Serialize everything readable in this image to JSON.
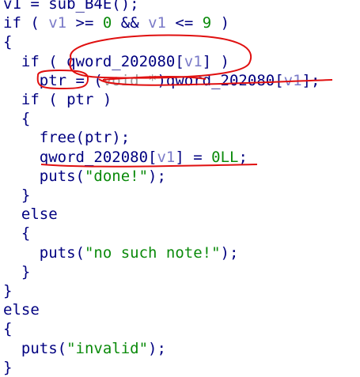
{
  "code": {
    "lines": [
      [
        {
          "t": "v1",
          "c": "plain"
        },
        {
          "t": " = sub_B4E();",
          "c": "plain"
        }
      ],
      [
        {
          "t": "if ( ",
          "c": "plain"
        },
        {
          "t": "v1",
          "c": "var"
        },
        {
          "t": " >= ",
          "c": "plain"
        },
        {
          "t": "0",
          "c": "num"
        },
        {
          "t": " && ",
          "c": "plain"
        },
        {
          "t": "v1",
          "c": "var"
        },
        {
          "t": " <= ",
          "c": "plain"
        },
        {
          "t": "9",
          "c": "num"
        },
        {
          "t": " )",
          "c": "plain"
        }
      ],
      [
        {
          "t": "{",
          "c": "plain"
        }
      ],
      [
        {
          "t": "  if ( qword_202080[",
          "c": "plain"
        },
        {
          "t": "v1",
          "c": "var"
        },
        {
          "t": "] )",
          "c": "plain"
        }
      ],
      [
        {
          "t": "    ptr = (",
          "c": "plain"
        },
        {
          "t": "void *",
          "c": "type"
        },
        {
          "t": ")qword_202080[",
          "c": "plain"
        },
        {
          "t": "v1",
          "c": "var"
        },
        {
          "t": "];",
          "c": "plain"
        }
      ],
      [
        {
          "t": "  if ( ptr )",
          "c": "plain"
        }
      ],
      [
        {
          "t": "  {",
          "c": "plain"
        }
      ],
      [
        {
          "t": "    free(ptr);",
          "c": "plain"
        }
      ],
      [
        {
          "t": "    qword_202080[",
          "c": "plain"
        },
        {
          "t": "v1",
          "c": "var"
        },
        {
          "t": "] = ",
          "c": "plain"
        },
        {
          "t": "0LL",
          "c": "num"
        },
        {
          "t": ";",
          "c": "plain"
        }
      ],
      [
        {
          "t": "    puts(",
          "c": "plain"
        },
        {
          "t": "\"done!\"",
          "c": "str"
        },
        {
          "t": ");",
          "c": "plain"
        }
      ],
      [
        {
          "t": "  }",
          "c": "plain"
        }
      ],
      [
        {
          "t": "  else",
          "c": "plain"
        }
      ],
      [
        {
          "t": "  {",
          "c": "plain"
        }
      ],
      [
        {
          "t": "    puts(",
          "c": "plain"
        },
        {
          "t": "\"no such note!\"",
          "c": "str"
        },
        {
          "t": ");",
          "c": "plain"
        }
      ],
      [
        {
          "t": "  }",
          "c": "plain"
        }
      ],
      [
        {
          "t": "}",
          "c": "plain"
        }
      ],
      [
        {
          "t": "else",
          "c": "plain"
        }
      ],
      [
        {
          "t": "{",
          "c": "plain"
        }
      ],
      [
        {
          "t": "  puts(",
          "c": "plain"
        },
        {
          "t": "\"invalid\"",
          "c": "str"
        },
        {
          "t": ");",
          "c": "plain"
        }
      ],
      [
        {
          "t": "}",
          "c": "plain"
        }
      ]
    ]
  },
  "colors": {
    "background": "#ffffff",
    "code_text": "#000080",
    "variable": "#7a7ac8",
    "literal": "#0a8a0a",
    "type": "#9a9a9a",
    "annotation": "#e01010"
  }
}
